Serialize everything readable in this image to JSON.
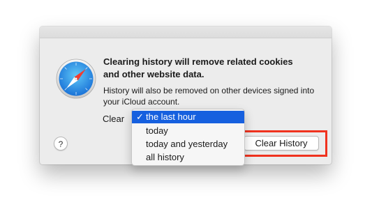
{
  "dialog": {
    "icon": "safari-compass-icon",
    "headline_line1": "Clearing history will remove related cookies",
    "headline_line2": "and other website data.",
    "subtext_line1": "History will also be removed on other devices signed into",
    "subtext_line2": "your iCloud account.",
    "clear_label": "Clear",
    "help_label": "?",
    "clear_button_label": "Clear History"
  },
  "menu": {
    "check_glyph": "✓",
    "items": [
      {
        "label": "the last hour",
        "selected": true
      },
      {
        "label": "today",
        "selected": false
      },
      {
        "label": "today and yesterday",
        "selected": false
      },
      {
        "label": "all history",
        "selected": false
      }
    ]
  },
  "colors": {
    "selection": "#1660df",
    "highlight": "#f0321e",
    "dialog_bg": "#ececec"
  }
}
